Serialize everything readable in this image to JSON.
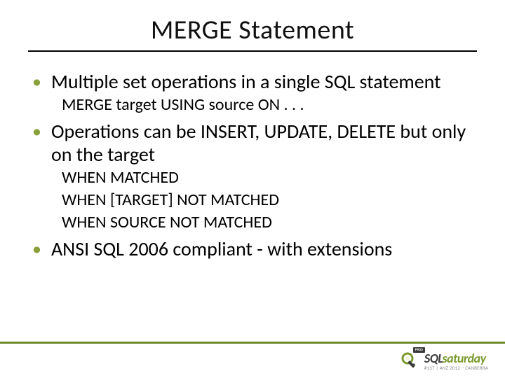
{
  "title": "MERGE Statement",
  "bullets": {
    "b1": {
      "text": "Multiple set operations in a single SQL statement",
      "sub": "MERGE target USING source ON . . ."
    },
    "b2": {
      "text": "Operations can be INSERT, UPDATE, DELETE but only on the target",
      "sub1": "WHEN MATCHED",
      "sub2": "WHEN [TARGET] NOT MATCHED",
      "sub3": "WHEN SOURCE NOT MATCHED"
    },
    "b3": {
      "text": "ANSI SQL 2006 compliant - with extensions"
    }
  },
  "footer": {
    "pass": "PASS",
    "brand_dark": "SQL",
    "brand_green": "saturday",
    "event": "#137 | ANZ 2012 – CANBERRA"
  }
}
